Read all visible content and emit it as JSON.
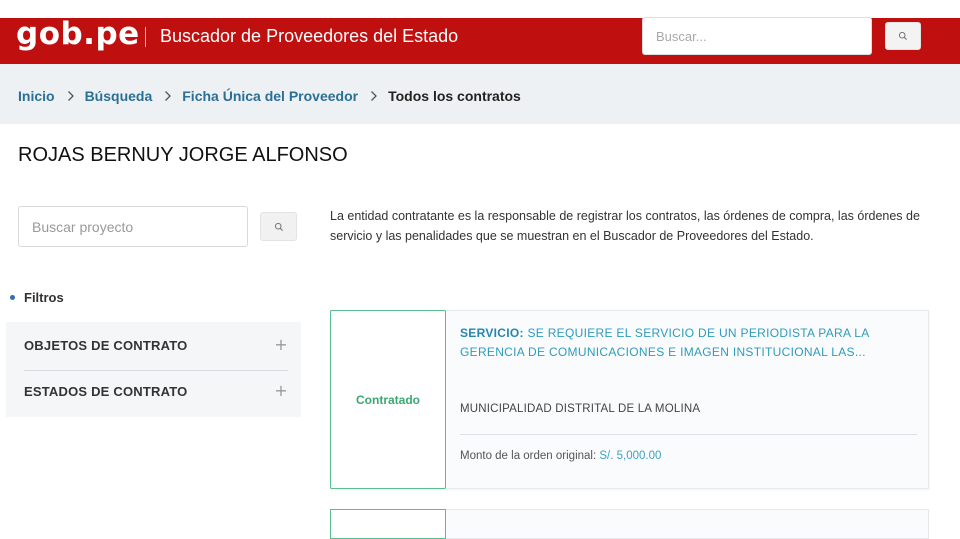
{
  "header": {
    "logo": "gob.pe",
    "site_title": "Buscador de Proveedores del Estado",
    "search_placeholder": "Buscar...",
    "search_button_icon": "search-icon",
    "brand_color": "#c00f0f"
  },
  "breadcrumb": {
    "items": [
      "Inicio",
      "Búsqueda",
      "Ficha Única del Proveedor"
    ],
    "current": "Todos los contratos"
  },
  "provider": {
    "name": "ROJAS BERNUY JORGE ALFONSO"
  },
  "sidebar": {
    "search_placeholder": "Buscar proyecto",
    "filters_title": "Filtros",
    "filters": [
      {
        "label": "OBJETOS DE CONTRATO",
        "icon": "plus-icon"
      },
      {
        "label": "ESTADOS DE CONTRATO",
        "icon": "plus-icon"
      }
    ]
  },
  "main": {
    "notice": "La entidad contratante es la responsable de registrar los contratos, las órdenes de compra, las órdenes de servicio y las penalidades que se muestran en el Buscador de Proveedores del Estado.",
    "contracts": [
      {
        "status": "Contratado",
        "status_color": "#3aa86f",
        "type": "SERVICIO:",
        "description": "SE REQUIERE EL SERVICIO DE UN PERIODISTA PARA LA GERENCIA DE COMUNICACIONES E IMAGEN INSTITUCIONAL LAS...",
        "entity": "MUNICIPALIDAD DISTRITAL DE LA MOLINA",
        "amount_label": "Monto de la orden original:",
        "amount_value": "S/. 5,000.00"
      }
    ]
  }
}
